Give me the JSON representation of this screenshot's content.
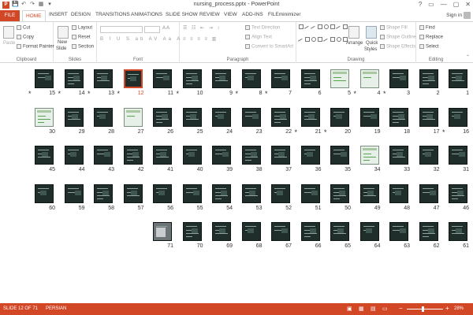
{
  "window": {
    "title": "nursing_process.pptx - PowerPoint",
    "controls": [
      "?",
      "▭",
      "—",
      "▢",
      "✕"
    ]
  },
  "qat": [
    "P",
    "💾",
    "↶",
    "↷",
    "▦",
    "▾"
  ],
  "tabs": [
    "FILE",
    "HOME",
    "INSERT",
    "DESIGN",
    "TRANSITIONS",
    "ANIMATIONS",
    "SLIDE SHOW",
    "REVIEW",
    "VIEW",
    "ADD-INS",
    "FILEminimizer"
  ],
  "signin": "Sign in",
  "ribbon": {
    "clipboard": {
      "label": "Clipboard",
      "paste": "Paste",
      "cut": "Cut",
      "copy": "Copy",
      "format_painter": "Format Painter"
    },
    "slides": {
      "label": "Slides",
      "new_slide": "New",
      "new_slide2": "Slide",
      "layout": "Layout",
      "reset": "Reset",
      "section": "Section"
    },
    "font": {
      "label": "Font"
    },
    "paragraph": {
      "label": "Paragraph",
      "text_direction": "Text Direction",
      "align_text": "Align Text",
      "smartart": "Convert to SmartArt"
    },
    "drawing": {
      "label": "Drawing",
      "arrange": "Arrange",
      "quick_styles": "Quick",
      "quick_styles2": "Styles",
      "shape_fill": "Shape Fill",
      "shape_outline": "Shape Outline",
      "shape_effects": "Shape Effects"
    },
    "editing": {
      "label": "Editing",
      "find": "Find",
      "replace": "Replace",
      "select": "Select"
    }
  },
  "slides": [
    {
      "n": "15",
      "star": true
    },
    {
      "n": "14",
      "star": true
    },
    {
      "n": "13",
      "star": true
    },
    {
      "n": "12",
      "star": true,
      "selected": true
    },
    {
      "n": "11"
    },
    {
      "n": "10",
      "star": true
    },
    {
      "n": "9"
    },
    {
      "n": "8",
      "star": true
    },
    {
      "n": "7",
      "star": true
    },
    {
      "n": "6"
    },
    {
      "n": "5",
      "light": true
    },
    {
      "n": "4",
      "star": true,
      "light": true
    },
    {
      "n": "3",
      "star": true
    },
    {
      "n": "2"
    },
    {
      "n": "1"
    },
    {
      "n": "30",
      "light": true
    },
    {
      "n": "29"
    },
    {
      "n": "28"
    },
    {
      "n": "27",
      "light": true
    },
    {
      "n": "26"
    },
    {
      "n": "25"
    },
    {
      "n": "24"
    },
    {
      "n": "23"
    },
    {
      "n": "22"
    },
    {
      "n": "21",
      "star": true
    },
    {
      "n": "20",
      "star": true
    },
    {
      "n": "19"
    },
    {
      "n": "18"
    },
    {
      "n": "17"
    },
    {
      "n": "16",
      "star": true
    },
    {
      "n": "45"
    },
    {
      "n": "44"
    },
    {
      "n": "43"
    },
    {
      "n": "42"
    },
    {
      "n": "41"
    },
    {
      "n": "40"
    },
    {
      "n": "39"
    },
    {
      "n": "38"
    },
    {
      "n": "37"
    },
    {
      "n": "36"
    },
    {
      "n": "35"
    },
    {
      "n": "34",
      "light": true
    },
    {
      "n": "33"
    },
    {
      "n": "32"
    },
    {
      "n": "31"
    },
    {
      "n": "60"
    },
    {
      "n": "59"
    },
    {
      "n": "58"
    },
    {
      "n": "57"
    },
    {
      "n": "56"
    },
    {
      "n": "55"
    },
    {
      "n": "54"
    },
    {
      "n": "53"
    },
    {
      "n": "52"
    },
    {
      "n": "51"
    },
    {
      "n": "50"
    },
    {
      "n": "49"
    },
    {
      "n": "48"
    },
    {
      "n": "47"
    },
    {
      "n": "46"
    },
    {
      "n": "71",
      "photo": true
    },
    {
      "n": "70"
    },
    {
      "n": "69"
    },
    {
      "n": "68"
    },
    {
      "n": "67"
    },
    {
      "n": "66"
    },
    {
      "n": "65"
    },
    {
      "n": "64"
    },
    {
      "n": "63"
    },
    {
      "n": "62"
    },
    {
      "n": "61"
    }
  ],
  "status": {
    "slide": "SLIDE 12 OF 71",
    "language": "PERSIAN",
    "zoom": "28%",
    "zoom_level": 0.28
  }
}
